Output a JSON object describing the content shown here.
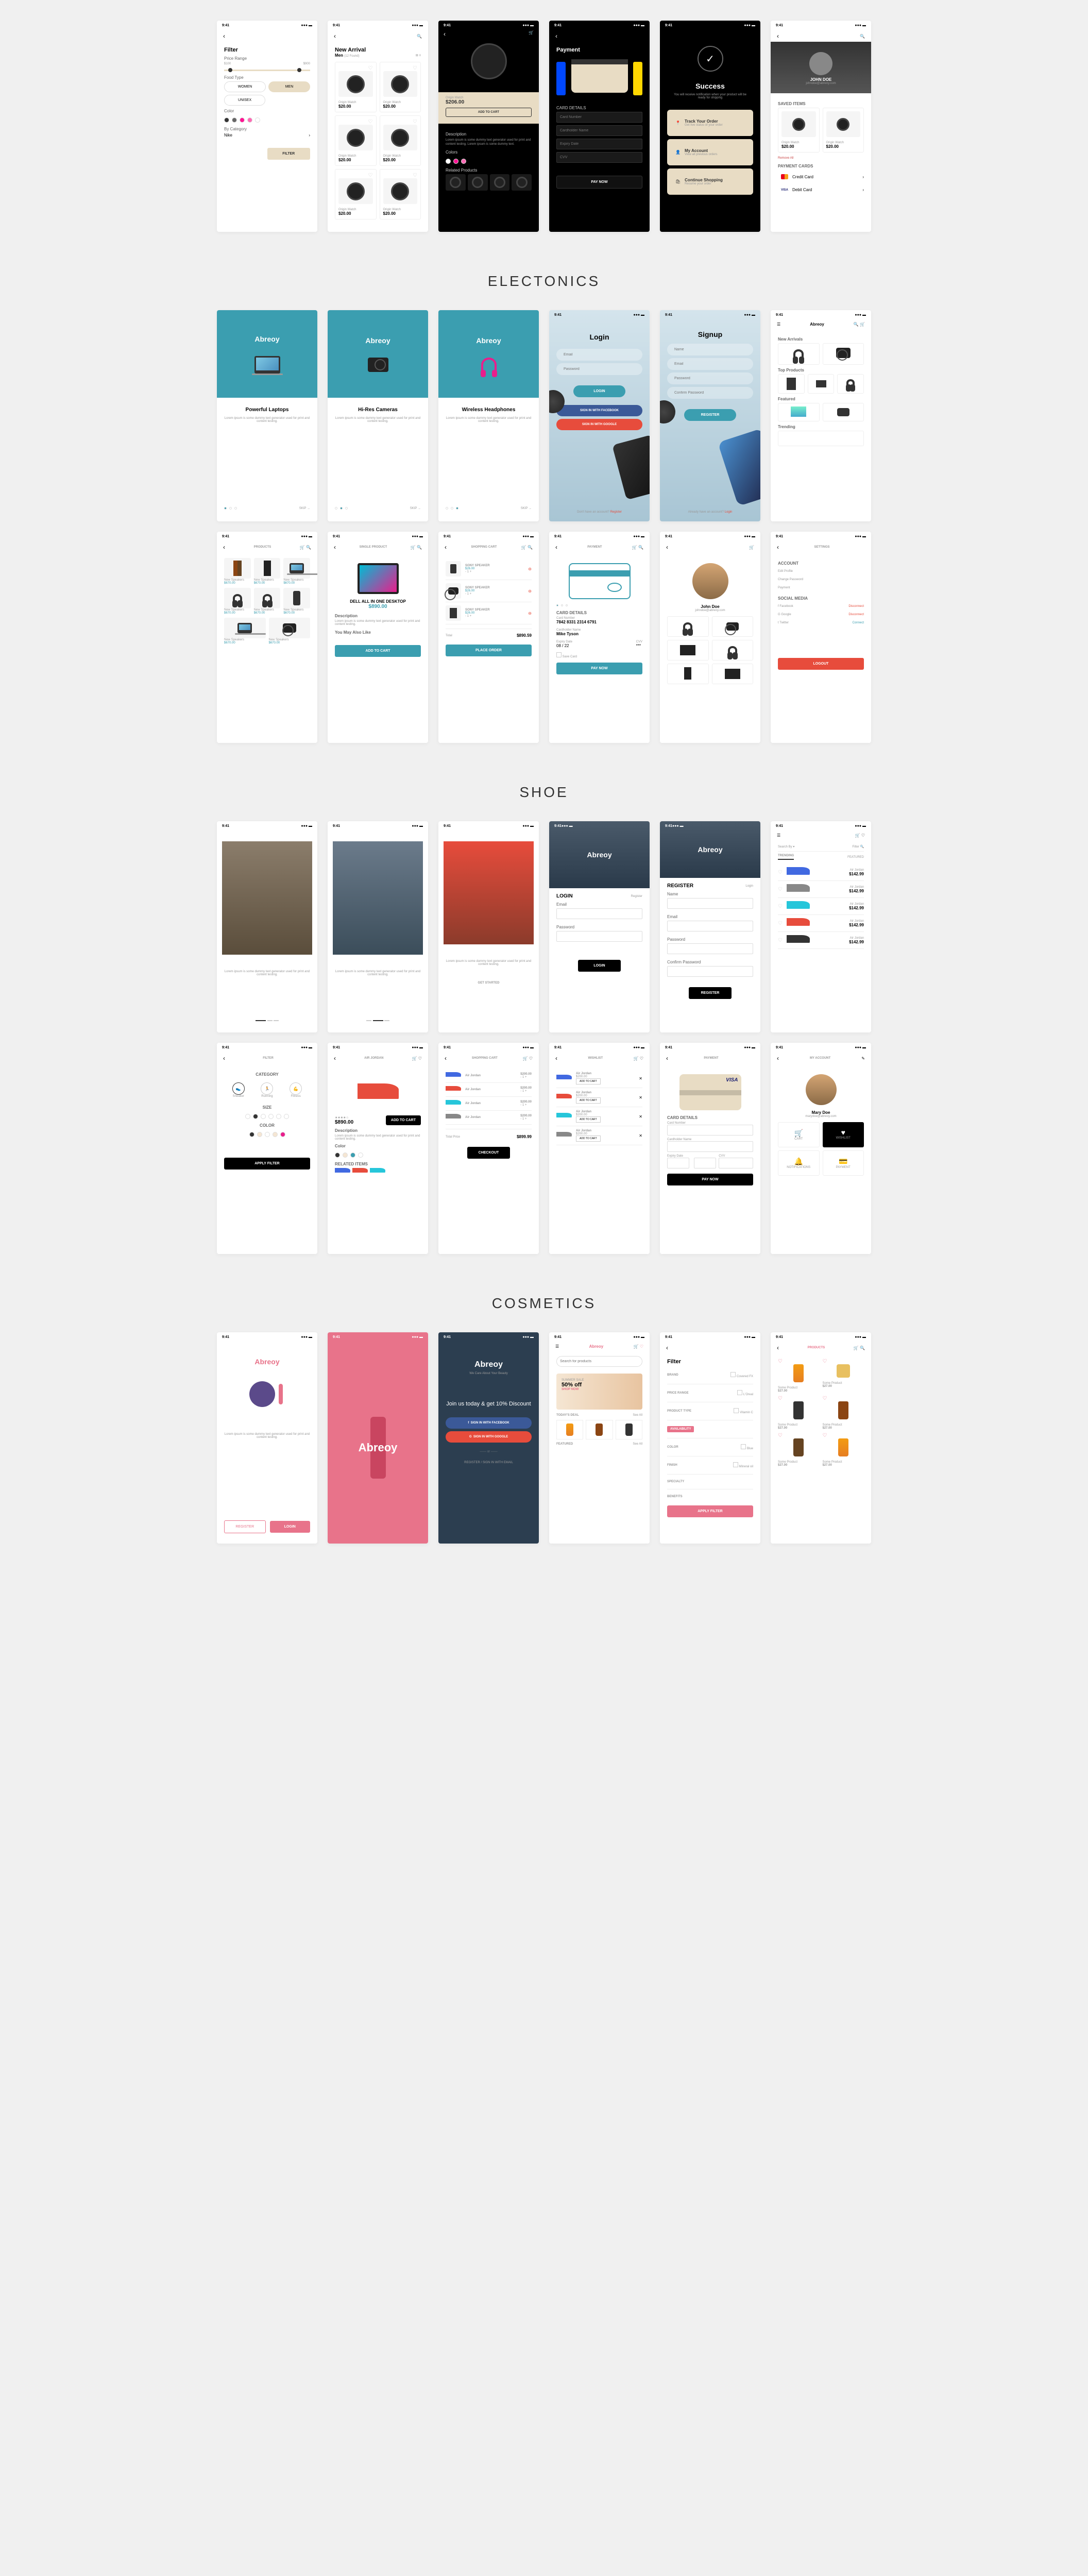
{
  "status": {
    "time": "9:41"
  },
  "sections": {
    "electronics": "ELECTONICS",
    "shoe": "SHOE",
    "cosmetics": "COSMETICS"
  },
  "watch": {
    "filter": {
      "title": "Filter",
      "priceRange": "Price Range",
      "min": "$100",
      "max": "$900",
      "foodType": "Food Type",
      "women": "WOMEN",
      "men": "MEN",
      "unisex": "UNISEX",
      "color": "Color",
      "byCategory": "By Category",
      "nike": "Nike",
      "filterBtn": "FILTER"
    },
    "newArrival": {
      "title": "New Arrival",
      "subtitle": "Men",
      "count": "(12 Found)",
      "product": "Origin Watch",
      "price": "$20.00"
    },
    "detail": {
      "product": "Origin Watch",
      "price": "$206.00",
      "addCart": "ADD TO CART",
      "desc": "Description",
      "descText": "Lorem ipsum is some dummy text generator used for print and content testing. Lorem ipsum is some dummy text.",
      "colors": "Colors",
      "related": "Related Products"
    },
    "payment": {
      "title": "Payment",
      "cardDetails": "CARD DETAILS",
      "cardNum": "Card Number",
      "cardName": "Cardholder Name",
      "expiry": "Expiry Date",
      "cvv": "CVV",
      "payNow": "PAY NOW"
    },
    "success": {
      "title": "Success",
      "msg": "You will receive notification when your product will be ready for shipping",
      "track": "Track Your Order",
      "trackSub": "Get live status of your order",
      "account": "My Account",
      "accountSub": "View all previous orders",
      "continue": "Continue Shopping",
      "continueSub": "Resume your order"
    },
    "profile": {
      "name": "JOHN DOE",
      "email": "johndoe@abreoy.com",
      "saved": "SAVED ITEMS",
      "product": "Origin Watch",
      "price": "$20.00",
      "removeAll": "Remove All",
      "paymentCards": "PAYMENT CARDS",
      "creditCard": "Credit Card",
      "debitCard": "Debit Card"
    }
  },
  "elec": {
    "brand": "Abreoy",
    "splash1": {
      "title": "Powerful Laptops",
      "desc": "Lorem ipsum is some dummy text generator used for print and content testing."
    },
    "splash2": {
      "title": "Hi-Res Cameras",
      "desc": "Lorem ipsum is some dummy text generator used for print and content testing."
    },
    "splash3": {
      "title": "Wireless Headphones",
      "desc": "Lorem ipsum is some dummy text generator used for print and content testing."
    },
    "skip": "SKIP →",
    "login": {
      "title": "Login",
      "email": "Email",
      "password": "Password",
      "loginBtn": "LOGIN",
      "fb": "SIGN IN WITH FACEBOOK",
      "google": "SIGN IN WITH GOOGLE",
      "noAccount": "Don't have an account?",
      "register": "Register"
    },
    "signup": {
      "title": "Signup",
      "name": "Name",
      "email": "Email",
      "password": "Password",
      "confirm": "Confirm Password",
      "registerBtn": "REGISTER",
      "haveAccount": "Already have an account?",
      "login": "Login"
    },
    "home": {
      "newArrivals": "New Arrivals",
      "topProducts": "Top Products",
      "featured": "Featured",
      "trending": "Trending"
    },
    "products": {
      "title": "PRODUCTS",
      "speakers": "New Speakers",
      "price": "$670.00"
    },
    "single": {
      "title": "SINGLE PRODUCT",
      "name": "DELL ALL IN ONE DESKTOP",
      "price": "$890.00",
      "desc": "Description",
      "descText": "Lorem ipsum is some dummy text generator used for print and content testing.",
      "youMay": "You May Also Like",
      "addCart": "ADD TO CART"
    },
    "cart": {
      "title": "SHOPPING CART",
      "item": "SONY SPEAKER",
      "price": "$26.00",
      "total": "Total",
      "totalPrice": "$890.59",
      "place": "PLACE ORDER"
    },
    "payment": {
      "title": "PAYMENT",
      "cardDetails": "CARD DETAILS",
      "cardNum": "Card Number",
      "cardNumVal": "7842  8331  2314  6791",
      "cardName": "Cardholder Name",
      "cardNameVal": "Mike Tyson",
      "expiry": "Expiry Date",
      "cvv": "CVV",
      "month": "08",
      "year": "22",
      "save": "Save Card",
      "payNow": "PAY NOW"
    },
    "seller": {
      "name": "John Doe",
      "email": "johndoe@abreoy.com"
    },
    "settings": {
      "title": "SETTINGS",
      "account": "ACCOUNT",
      "editProfile": "Edit Profile",
      "changePass": "Change Password",
      "payment": "Payment",
      "social": "SOCIAL MEDIA",
      "fb": "Facebook",
      "google": "Google",
      "twitter": "Twitter",
      "disconnect": "Disconnect",
      "connect": "Connect",
      "logout": "LOGOUT"
    }
  },
  "shoe": {
    "brand": "Abreoy",
    "splashDesc": "Lorem ipsum is some dummy text generator used for print and content testing.",
    "getStarted": "GET STARTED",
    "login": {
      "title": "LOGIN",
      "register": "Register",
      "email": "Email",
      "password": "Password",
      "loginBtn": "LOGIN"
    },
    "register": {
      "title": "REGISTER",
      "login": "Login",
      "name": "Name",
      "email": "Email",
      "password": "Password",
      "confirm": "Confirm Password",
      "registerBtn": "REGISTER"
    },
    "list": {
      "searchBy": "Search By",
      "filter": "Filter",
      "trending": "TRENDING",
      "featured": "FEATURED",
      "product": "Air Jordan",
      "price": "$142.99"
    },
    "filter": {
      "title": "FILTER",
      "category": "CATEGORY",
      "sneaker": "Sneaker",
      "running": "Running",
      "fitness": "Fitness",
      "size": "SIZE",
      "color": "COLOR",
      "apply": "APPLY FILTER"
    },
    "detail": {
      "title": "AIR JORDAN",
      "price": "$890.00",
      "addCart": "ADD TO CART",
      "desc": "Description",
      "descText": "Lorem ipsum is some dummy text generator used for print and content testing.",
      "color": "Color",
      "related": "RELATED ITEMS"
    },
    "cart": {
      "title": "SHOPPING CART",
      "item": "Air Jordan",
      "price": "$200.00",
      "price2": "$26.00",
      "total": "Total Price",
      "totalVal": "$899.99",
      "checkout": "CHECKOUT"
    },
    "wishlist": {
      "title": "WISHLIST",
      "item": "Air Jordan",
      "price": "$200.00",
      "addCart": "ADD TO CART"
    },
    "payment": {
      "title": "PAYMENT",
      "visa": "VISA",
      "cardDetails": "CARD DETAILS",
      "cardNum": "Card Number",
      "cardName": "Cardholder Name",
      "expiry": "Expiry Date",
      "cvv": "CVV",
      "payNow": "PAY NOW"
    },
    "account": {
      "title": "MY ACCOUNT",
      "name": "Mary Doe",
      "email": "marydoe@abreoy.com",
      "cart": "CART",
      "wishlist": "WISHLIST",
      "notif": "NOTIFICATIONS",
      "payment": "PAYMENT"
    }
  },
  "cos": {
    "brand": "Abreoy",
    "splashDesc": "Lorem ipsum is some dummy text generator used for print and content testing.",
    "register": "REGISTER",
    "login": "LOGIN",
    "tagline": "We Care About Your Beauty",
    "join": "Join us today & get 10% Discount",
    "fb": "SIGN IN WITH FACEBOOK",
    "google": "SIGN IN WITH GOOGLE",
    "emailReg": "REGISTER / SIGN IN WITH EMAIL",
    "home": {
      "searchPh": "Search for products",
      "summerSale": "SUMMER SALE",
      "discount": "50% off",
      "shopNow": "SHOP NOW",
      "todayDeal": "TODAY'S DEAL",
      "seeAll": "See All",
      "featured": "FEATURED"
    },
    "filter": {
      "title": "Filter",
      "brand": "BRAND",
      "priceRange": "PRICE RANGE",
      "productType": "PRODUCT TYPE",
      "availability": "AVAILABILITY",
      "color": "COLOR",
      "finish": "FINISH",
      "specialty": "SPECIALTY",
      "benefits": "BENEFITS",
      "covered": "Covered FX",
      "lOreal": "L'Oreal",
      "vitaminC": "Vitamin C",
      "blue": "Blue",
      "mineral": "Mineral oil",
      "apply": "APPLY FILTER"
    },
    "products": {
      "title": "PRODUCTS",
      "item": "Some Product",
      "price": "$27.00"
    }
  }
}
